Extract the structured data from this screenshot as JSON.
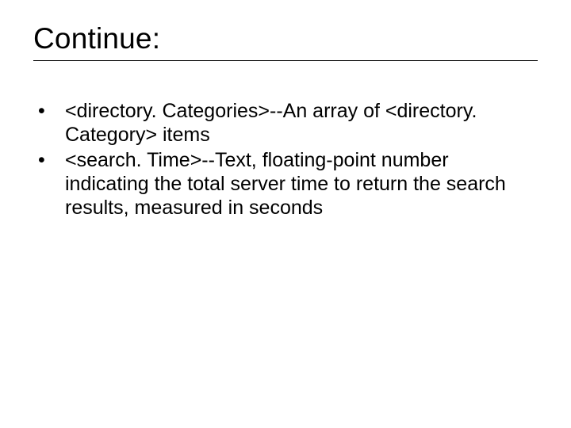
{
  "slide": {
    "title": "Continue:",
    "bullets": [
      "<directory. Categories>--An array of <directory. Category> items",
      "<search. Time>--Text, floating-point number indicating the total server time to return the search results, measured in seconds"
    ]
  }
}
